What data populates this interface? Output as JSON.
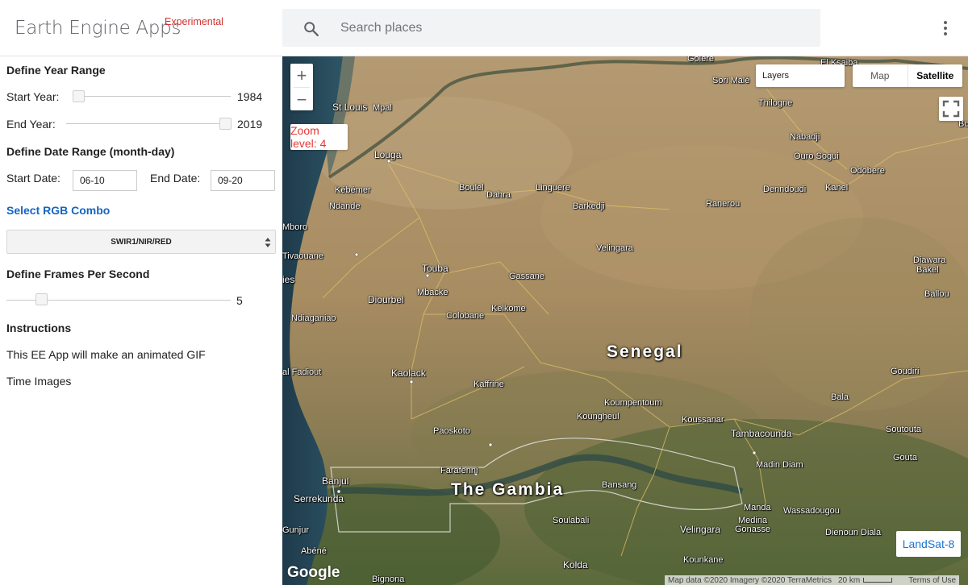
{
  "header": {
    "app_title": "Earth Engine Apps",
    "badge": "Experimental",
    "search_placeholder": "Search places"
  },
  "panel": {
    "year_section": "Define Year Range",
    "start_year_label": "Start Year:",
    "start_year_value": "1984",
    "end_year_label": "End Year:",
    "end_year_value": "2019",
    "date_section": "Define Date Range (month-day)",
    "start_date_label": "Start Date:",
    "start_date_value": "06-10",
    "end_date_label": "End Date:",
    "end_date_value": "09-20",
    "rgb_link": "Select RGB Combo",
    "rgb_selected": "SWIR1/NIR/RED",
    "fps_section": "Define Frames Per Second",
    "fps_value": "5",
    "instructions_title": "Instructions",
    "instruction_line_1": "This EE App will make an animated GIF",
    "instruction_line_2": "Time Images"
  },
  "map": {
    "zoom_label": "Zoom level: 4",
    "zoom_in": "+",
    "zoom_out": "−",
    "layers_label": "Layers",
    "map_type_map": "Map",
    "map_type_satellite": "Satellite",
    "landsat_label": "LandSat-8",
    "google_logo": "Google",
    "attribution": "Map data ©2020 Imagery ©2020 TerraMetrics",
    "scale": "20 km",
    "terms": "Terms of Use",
    "countries": {
      "senegal": "Senegal",
      "gambia": "The Gambia"
    },
    "places": {
      "golere": "Golere",
      "sori_male": "Sori Malé",
      "el_ksaiba": "El Ksaiba",
      "thilogne": "Thilogne",
      "st_louis": "St Louis",
      "mpal": "Mpal",
      "nabadji": "Nabadji",
      "louga": "Louga",
      "ouro_sogui": "Ouro Sogui",
      "odobere": "Odobere",
      "kebemer": "Kébémer",
      "boulel": "Boulel",
      "dahra": "Dahra",
      "linguere": "Linguere",
      "dendoudi": "Denndoudi",
      "kanel": "Kanel",
      "ndande": "Ndande",
      "barkedji": "Barkedji",
      "ranerou": "Ranerou",
      "mboro": "Mboro",
      "velingara_n": "Velingara",
      "tivaouane": "Tivaouane",
      "diawara": "Diawara",
      "bakel": "Bakel",
      "touba": "Touba",
      "gassane": "Gassane",
      "thies": "ies",
      "mbacke": "Mbacke",
      "diourbel": "Diourbel",
      "ballou": "Ballou",
      "kelkome": "Kelkome",
      "ndiaganiao": "Ndiaganiao",
      "colobane": "Colobane",
      "fadiout": "al Fadiout",
      "kaolack": "Kaolack",
      "goudiri": "Goudiri",
      "kaffrine": "Kaffrine",
      "bala": "Bala",
      "koumpentoum": "Koumpentoum",
      "koungheul": "Koungheul",
      "koussanar": "Koussanar",
      "tambacounda": "Tambacounda",
      "paoskoto": "Paoskoto",
      "soutouta": "Soutouta",
      "farafenni": "Farafenni",
      "gouta": "Gouta",
      "madin_diam": "Madin Diam",
      "banjul": "Banjul",
      "bansang": "Bansang",
      "serrekunda": "Serrekunda",
      "manda": "Manda",
      "wassadougou": "Wassadougou",
      "medina_gonasse": "Medina",
      "gonasse": "Gonasse",
      "soulabali": "Soulabali",
      "gunjur": "Gunjur",
      "velingara_s": "Velingara",
      "dienoun_diala": "Dienoun Diala",
      "abene": "Abéné",
      "kounkane": "Kounkane",
      "kolda": "Kolda",
      "bignona": "Bignona",
      "bo": "Bo"
    }
  }
}
